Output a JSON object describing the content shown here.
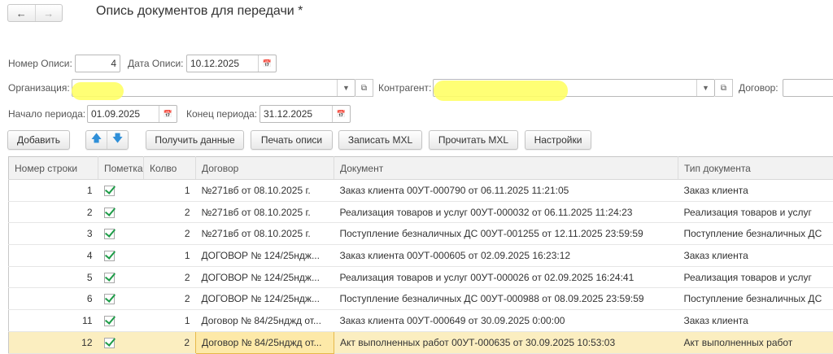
{
  "header": {
    "title": "Опись документов для передачи *",
    "back_icon": "arrow-left",
    "forward_icon": "arrow-right"
  },
  "form": {
    "nomer_label": "Номер Описи:",
    "nomer_value": "4",
    "data_label": "Дата Описи:",
    "data_value": "10.12.2025",
    "org_label": "Организация:",
    "kontragent_label": "Контрагент:",
    "dogovor_label": "Договор:",
    "start_label": "Начало периода:",
    "start_value": "01.09.2025",
    "end_label": "Конец периода:",
    "end_value": "31.12.2025"
  },
  "toolbar": {
    "add": "Добавить",
    "get_data": "Получить данные",
    "print": "Печать описи",
    "write_mxl": "Записать MXL",
    "read_mxl": "Прочитать MXL",
    "settings": "Настройки"
  },
  "table": {
    "columns": [
      "Номер строки",
      "Пометка",
      "Колво",
      "Договор",
      "Документ",
      "Тип документа"
    ],
    "rows": [
      {
        "num": "1",
        "qty": "1",
        "dogovor": "№271вб от 08.10.2025 г.",
        "doc": "Заказ клиента 00УТ-000790 от 06.11.2025 11:21:05",
        "type": "Заказ клиента"
      },
      {
        "num": "2",
        "qty": "2",
        "dogovor": "№271вб от 08.10.2025 г.",
        "doc": "Реализация товаров и услуг 00УТ-000032 от 06.11.2025 11:24:23",
        "type": "Реализация товаров и услуг"
      },
      {
        "num": "3",
        "qty": "2",
        "dogovor": "№271вб от 08.10.2025 г.",
        "doc": "Поступление безналичных ДС 00УТ-001255 от 12.11.2025 23:59:59",
        "type": "Поступление безналичных ДС"
      },
      {
        "num": "4",
        "qty": "1",
        "dogovor": "ДОГОВОР № 124/25ндж...",
        "doc": "Заказ клиента 00УТ-000605 от 02.09.2025 16:23:12",
        "type": "Заказ клиента"
      },
      {
        "num": "5",
        "qty": "2",
        "dogovor": "ДОГОВОР № 124/25ндж...",
        "doc": "Реализация товаров и услуг 00УТ-000026 от 02.09.2025 16:24:41",
        "type": "Реализация товаров и услуг"
      },
      {
        "num": "6",
        "qty": "2",
        "dogovor": "ДОГОВОР № 124/25ндж...",
        "doc": "Поступление безналичных ДС 00УТ-000988 от 08.09.2025 23:59:59",
        "type": "Поступление безналичных ДС"
      },
      {
        "num": "11",
        "qty": "1",
        "dogovor": "Договор № 84/25нджд от...",
        "doc": "Заказ клиента 00УТ-000649 от 30.09.2025 0:00:00",
        "type": "Заказ клиента"
      },
      {
        "num": "12",
        "qty": "2",
        "dogovor": "Договор № 84/25нджд от...",
        "doc": "Акт выполненных работ 00УТ-000635 от 30.09.2025 10:53:03",
        "type": "Акт выполненных работ"
      }
    ]
  }
}
